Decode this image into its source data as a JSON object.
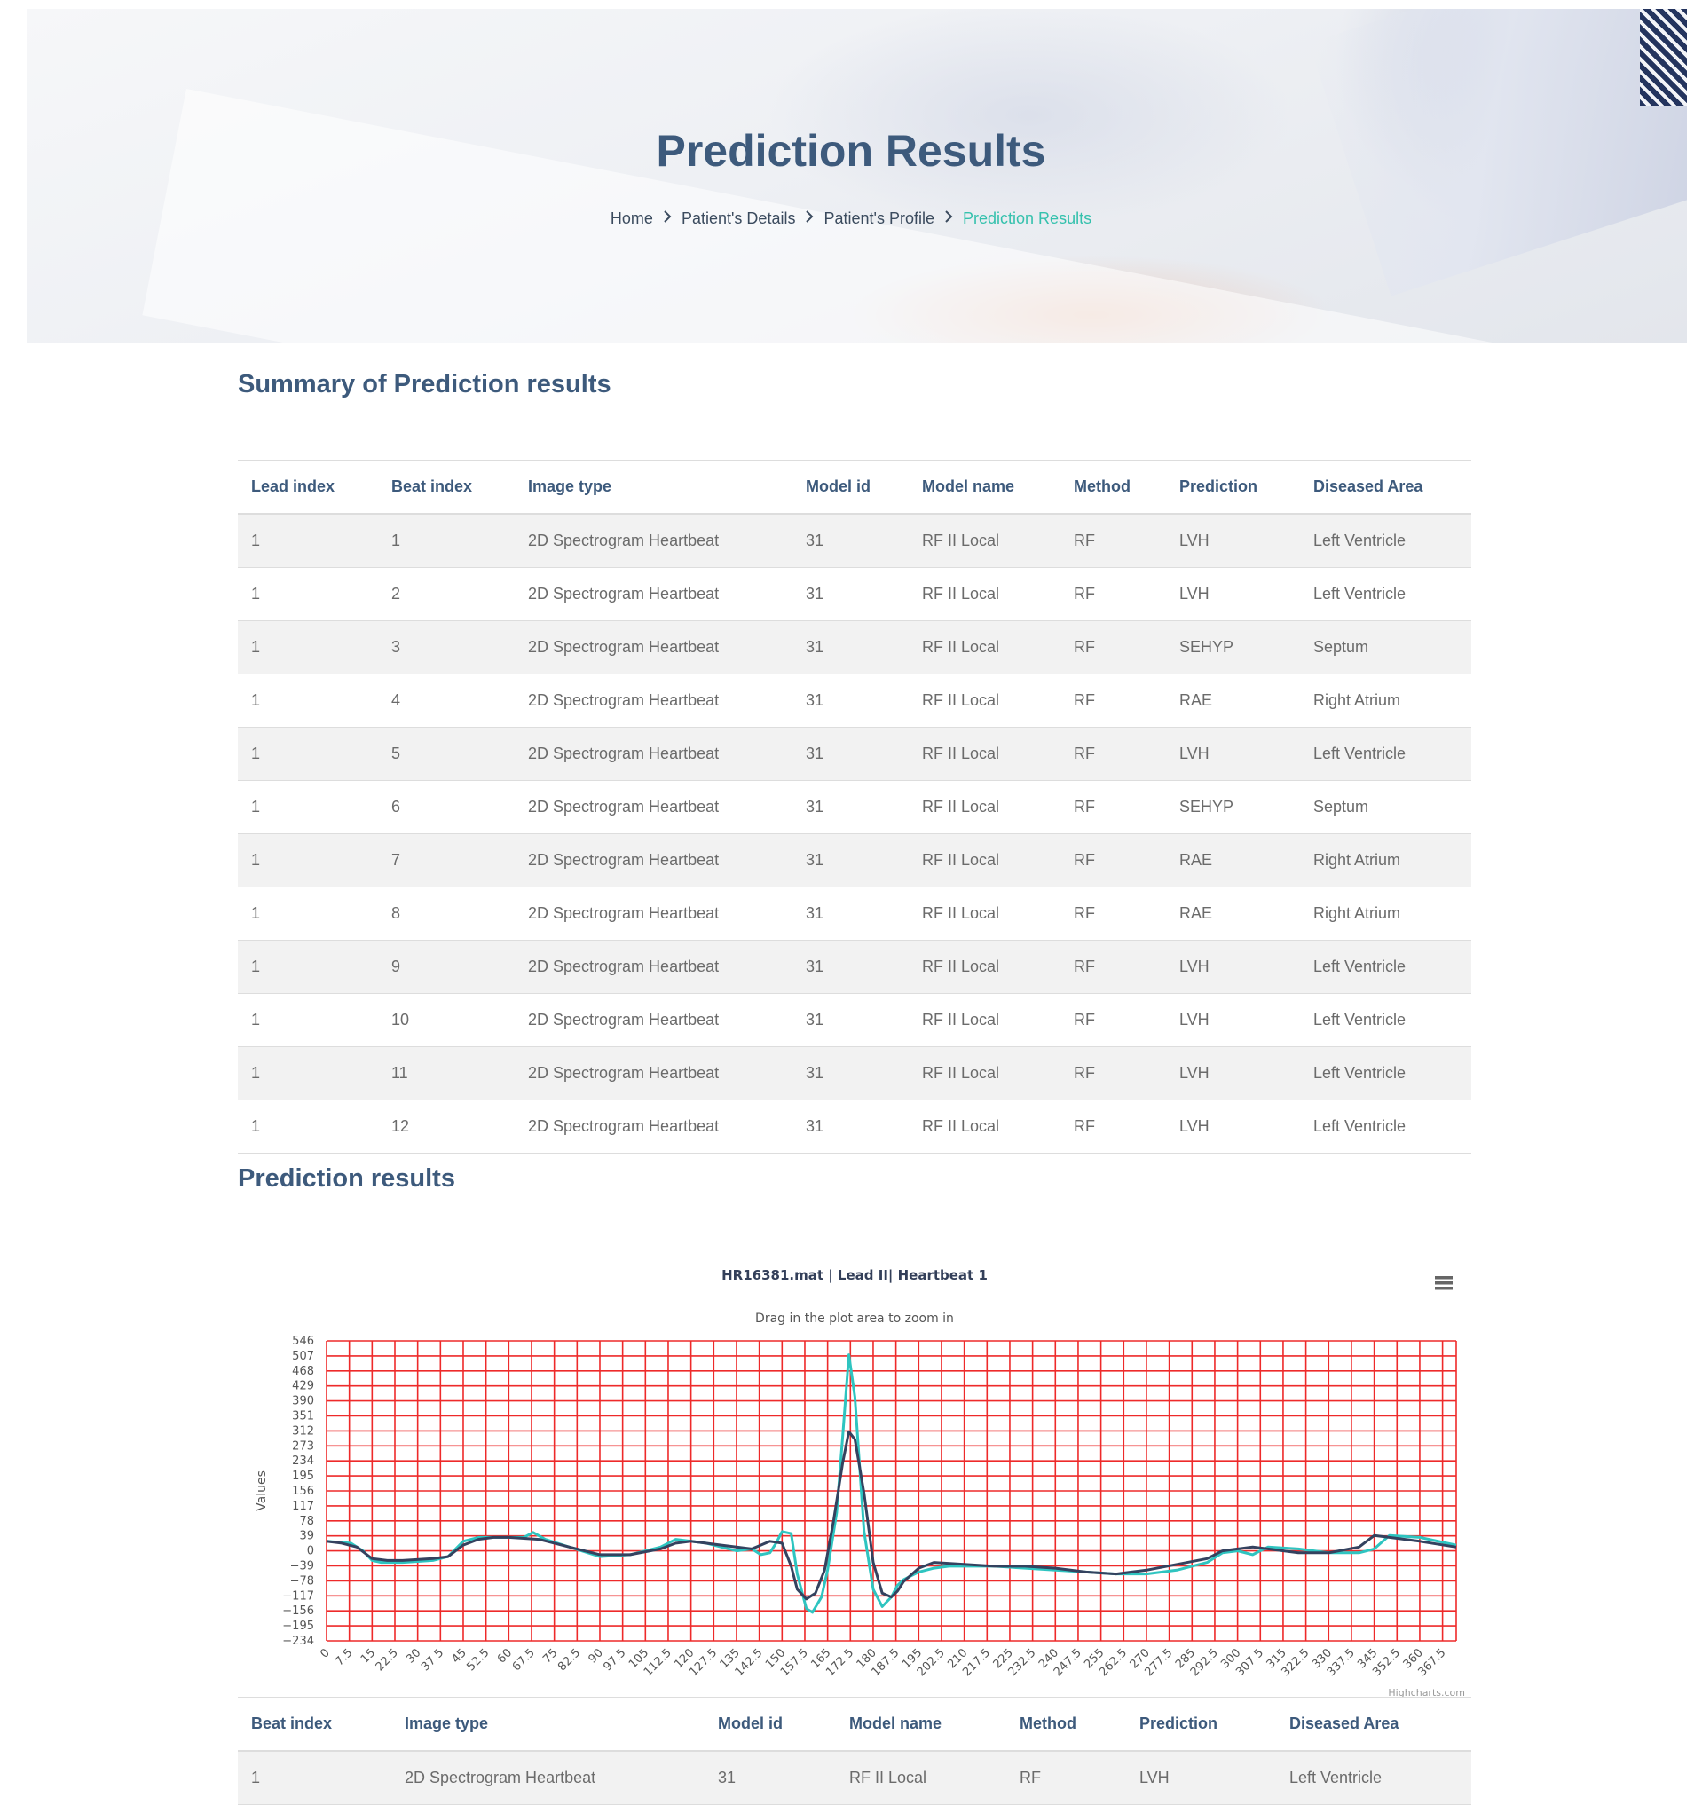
{
  "header": {
    "title": "Prediction Results",
    "breadcrumb": [
      "Home",
      "Patient's Details",
      "Patient's Profile",
      "Prediction Results"
    ]
  },
  "summary": {
    "title": "Summary of Prediction results",
    "columns": [
      "Lead index",
      "Beat index",
      "Image type",
      "Model id",
      "Model name",
      "Method",
      "Prediction",
      "Diseased Area"
    ],
    "rows": [
      [
        "1",
        "1",
        "2D Spectrogram Heartbeat",
        "31",
        "RF II Local",
        "RF",
        "LVH",
        "Left Ventricle"
      ],
      [
        "1",
        "2",
        "2D Spectrogram Heartbeat",
        "31",
        "RF II Local",
        "RF",
        "LVH",
        "Left Ventricle"
      ],
      [
        "1",
        "3",
        "2D Spectrogram Heartbeat",
        "31",
        "RF II Local",
        "RF",
        "SEHYP",
        "Septum"
      ],
      [
        "1",
        "4",
        "2D Spectrogram Heartbeat",
        "31",
        "RF II Local",
        "RF",
        "RAE",
        "Right Atrium"
      ],
      [
        "1",
        "5",
        "2D Spectrogram Heartbeat",
        "31",
        "RF II Local",
        "RF",
        "LVH",
        "Left Ventricle"
      ],
      [
        "1",
        "6",
        "2D Spectrogram Heartbeat",
        "31",
        "RF II Local",
        "RF",
        "SEHYP",
        "Septum"
      ],
      [
        "1",
        "7",
        "2D Spectrogram Heartbeat",
        "31",
        "RF II Local",
        "RF",
        "RAE",
        "Right Atrium"
      ],
      [
        "1",
        "8",
        "2D Spectrogram Heartbeat",
        "31",
        "RF II Local",
        "RF",
        "RAE",
        "Right Atrium"
      ],
      [
        "1",
        "9",
        "2D Spectrogram Heartbeat",
        "31",
        "RF II Local",
        "RF",
        "LVH",
        "Left Ventricle"
      ],
      [
        "1",
        "10",
        "2D Spectrogram Heartbeat",
        "31",
        "RF II Local",
        "RF",
        "LVH",
        "Left Ventricle"
      ],
      [
        "1",
        "11",
        "2D Spectrogram Heartbeat",
        "31",
        "RF II Local",
        "RF",
        "LVH",
        "Left Ventricle"
      ],
      [
        "1",
        "12",
        "2D Spectrogram Heartbeat",
        "31",
        "RF II Local",
        "RF",
        "LVH",
        "Left Ventricle"
      ]
    ]
  },
  "prediction": {
    "title": "Prediction results",
    "columns": [
      "Beat index",
      "Image type",
      "Model id",
      "Model name",
      "Method",
      "Prediction",
      "Diseased Area"
    ],
    "rows": [
      [
        "1",
        "2D Spectrogram Heartbeat",
        "31",
        "RF II Local",
        "RF",
        "LVH",
        "Left Ventricle"
      ]
    ]
  },
  "chart_data": {
    "type": "line",
    "title": "HR16381.mat | Lead II| Heartbeat 1",
    "subtitle": "Drag in the plot area to zoom in",
    "ylabel": "Values",
    "xlabel": "",
    "credit": "Highcharts.com",
    "menu_icon": "hamburger-menu-icon",
    "grid": true,
    "grid_color": "#ee2a2a",
    "xlim": [
      0,
      372
    ],
    "ylim": [
      -234,
      546
    ],
    "ytick_step": 39,
    "xtick_step": 7.5,
    "xticks": [
      "0",
      "7.5",
      "15",
      "22.5",
      "30",
      "37.5",
      "45",
      "52.5",
      "60",
      "67.5",
      "75",
      "82.5",
      "90",
      "97.5",
      "105",
      "112.5",
      "120",
      "127.5",
      "135",
      "142.5",
      "150",
      "157.5",
      "165",
      "172.5",
      "180",
      "187.5",
      "195",
      "202.5",
      "210",
      "217.5",
      "225",
      "232.5",
      "240",
      "247.5",
      "255",
      "262.5",
      "270",
      "277.5",
      "285",
      "292.5",
      "300",
      "307.5",
      "315",
      "322.5",
      "330",
      "337.5",
      "345",
      "352.5",
      "360",
      "367.5"
    ],
    "yticks": [
      "546",
      "507",
      "468",
      "429",
      "390",
      "351",
      "312",
      "273",
      "234",
      "195",
      "156",
      "117",
      "78",
      "39",
      "0",
      "−39",
      "−78",
      "−117",
      "−156",
      "−195",
      "−234"
    ],
    "series": [
      {
        "color": "#2ec4c0",
        "x": [
          0,
          8,
          12,
          15,
          18,
          25,
          35,
          40,
          45,
          50,
          55,
          60,
          65,
          68,
          72,
          80,
          90,
          100,
          110,
          115,
          120,
          125,
          130,
          135,
          140,
          143,
          146,
          148,
          150,
          153,
          155,
          158,
          160,
          163,
          165,
          168,
          170,
          172,
          174,
          177,
          180,
          183,
          186,
          188,
          190,
          195,
          200,
          205,
          210,
          220,
          230,
          240,
          250,
          260,
          270,
          280,
          290,
          295,
          300,
          305,
          310,
          320,
          330,
          340,
          345,
          350,
          360,
          372
        ],
        "y": [
          25,
          20,
          0,
          -25,
          -30,
          -30,
          -25,
          -15,
          25,
          35,
          35,
          35,
          35,
          48,
          30,
          10,
          -15,
          -10,
          10,
          30,
          25,
          20,
          10,
          0,
          5,
          -10,
          -5,
          20,
          50,
          45,
          -60,
          -150,
          -160,
          -120,
          -50,
          100,
          300,
          510,
          400,
          50,
          -100,
          -145,
          -120,
          -90,
          -75,
          -55,
          -45,
          -40,
          -40,
          -40,
          -45,
          -50,
          -55,
          -60,
          -60,
          -50,
          -30,
          -5,
          0,
          -10,
          10,
          5,
          -5,
          -5,
          5,
          40,
          35,
          15
        ]
      },
      {
        "color": "#34425f",
        "x": [
          0,
          5,
          10,
          15,
          20,
          25,
          35,
          40,
          45,
          50,
          55,
          60,
          70,
          80,
          90,
          100,
          110,
          115,
          120,
          130,
          140,
          143,
          146,
          150,
          153,
          155,
          158,
          161,
          164,
          167,
          170,
          172,
          174,
          177,
          180,
          183,
          186,
          188,
          190,
          195,
          200,
          210,
          220,
          230,
          240,
          250,
          260,
          270,
          280,
          290,
          295,
          300,
          305,
          310,
          320,
          330,
          340,
          345,
          350,
          360,
          372
        ],
        "y": [
          25,
          20,
          10,
          -20,
          -25,
          -25,
          -20,
          -15,
          15,
          30,
          35,
          35,
          30,
          10,
          -10,
          -10,
          5,
          20,
          25,
          15,
          5,
          15,
          25,
          20,
          -40,
          -100,
          -125,
          -110,
          -50,
          80,
          230,
          310,
          290,
          150,
          -30,
          -110,
          -120,
          -105,
          -80,
          -45,
          -30,
          -35,
          -40,
          -40,
          -45,
          -55,
          -60,
          -50,
          -35,
          -20,
          0,
          5,
          10,
          5,
          -5,
          -5,
          10,
          40,
          35,
          25,
          10
        ]
      }
    ]
  }
}
